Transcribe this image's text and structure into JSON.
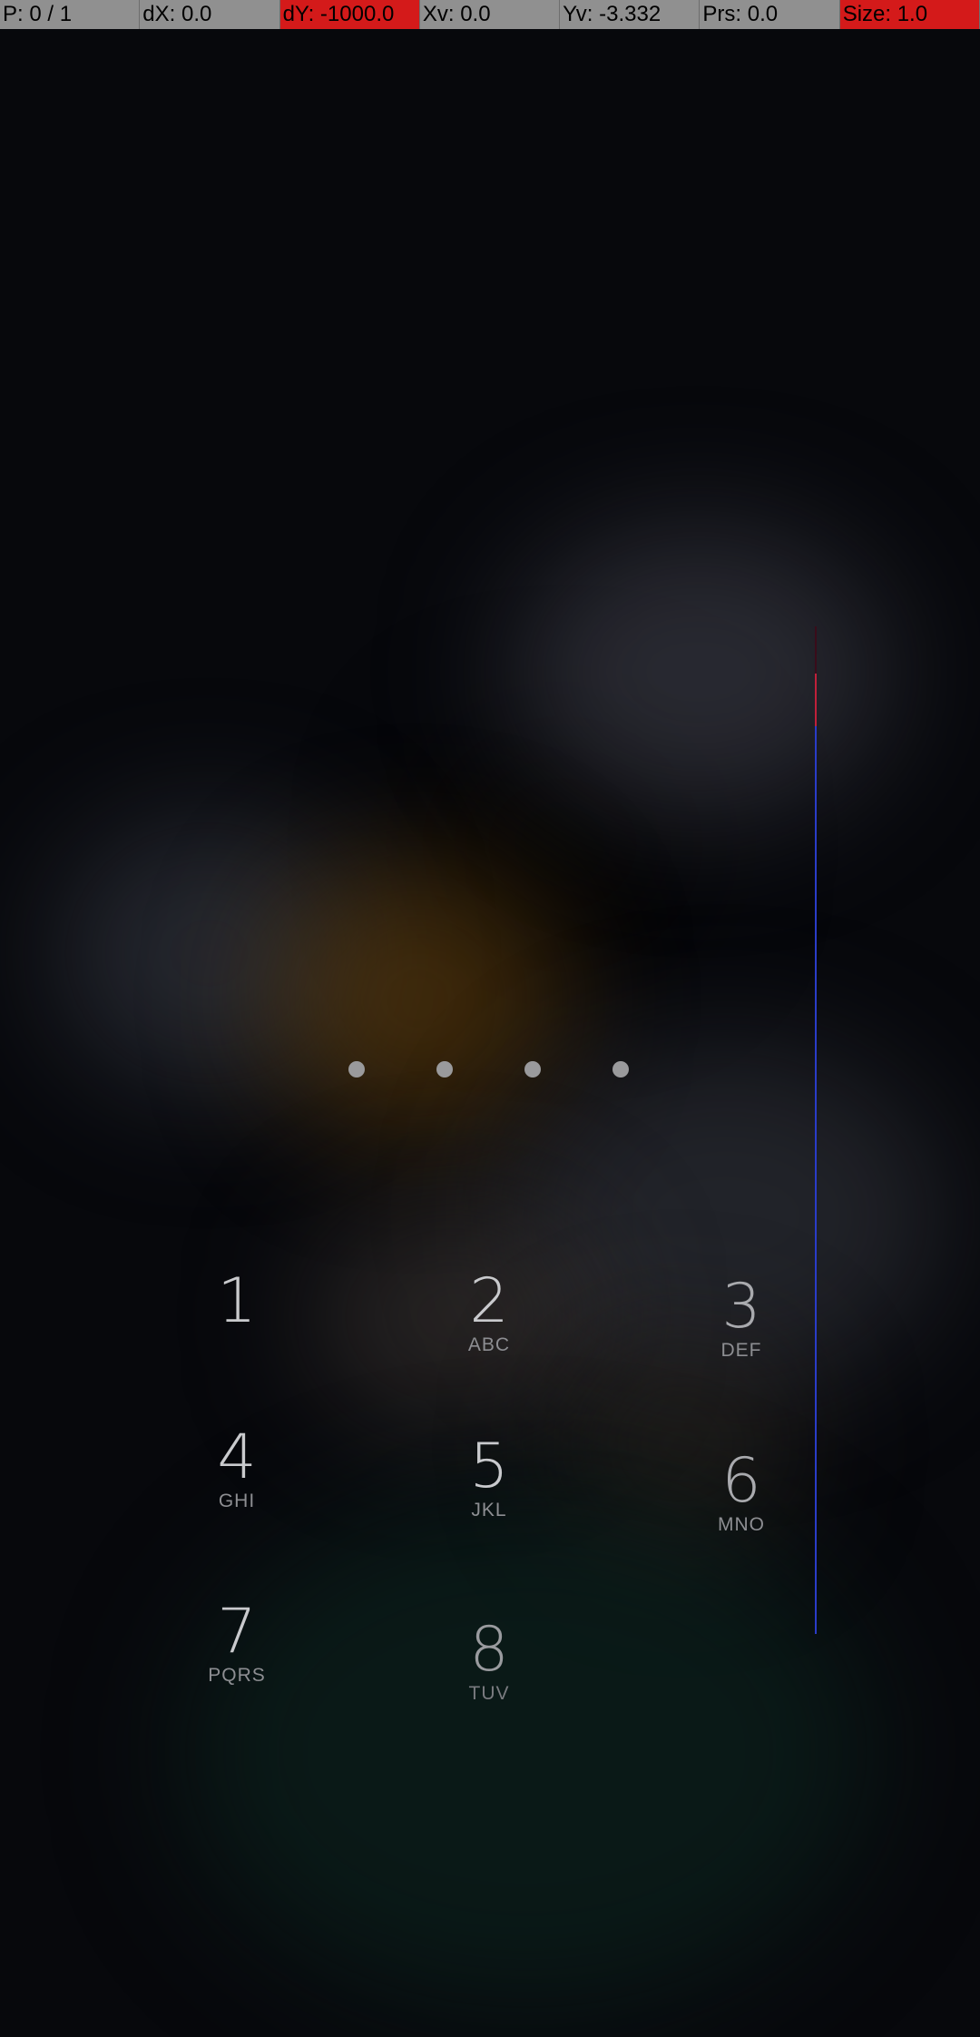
{
  "debug_bar": {
    "pointer": "P: 0 / 1",
    "dx": "dX: 0.0",
    "dy": "dY: -1000.0",
    "xv": "Xv: 0.0",
    "yv": "Yv: -3.332",
    "prs": "Prs: 0.0",
    "size": "Size: 1.0",
    "alert_color": "#d41a1a"
  },
  "pin": {
    "entered_digits": 4
  },
  "keypad": {
    "keys": [
      {
        "digit": "1",
        "letters": ""
      },
      {
        "digit": "2",
        "letters": "ABC"
      },
      {
        "digit": "3",
        "letters": "DEF"
      },
      {
        "digit": "4",
        "letters": "GHI"
      },
      {
        "digit": "5",
        "letters": "JKL"
      },
      {
        "digit": "6",
        "letters": "MNO"
      },
      {
        "digit": "7",
        "letters": "PQRS"
      },
      {
        "digit": "8",
        "letters": "TUV"
      }
    ]
  }
}
